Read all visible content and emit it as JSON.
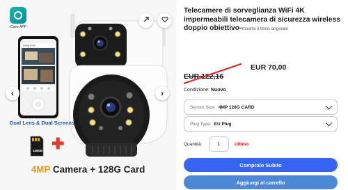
{
  "gallery": {
    "app_name": "iCsee APP",
    "phone_header": "Living room",
    "caption_lens": "Dual Lens & Dual Screens",
    "sd_card_label": "128GB",
    "caption_storage_prefix": "4MP",
    "caption_storage_rest": " Camera + 128G Card",
    "share_icon": "share-icon",
    "fav_icon": "heart-icon"
  },
  "listing": {
    "title": "Telecamere di sorveglianza WiFi 4K impermeabili telecamera di sicurezza wireless doppio obiettivo-",
    "original_title_link": "mostra il titolo originale",
    "old_price": "EUR 122,16",
    "new_price": "EUR 70,00",
    "condition_label": "Condizione:",
    "condition_value": "Nuovo",
    "sensor_label": "Sensor Size:",
    "sensor_value": "4MP 128G CARD",
    "plug_label": "Plug Type:",
    "plug_value": "EU Plug",
    "quantity_label": "Quantità:",
    "quantity_value": "1",
    "quantity_note": "Ultimo",
    "buy_now": "Compralo Subito",
    "add_to_cart": "Aggiungi al carrello"
  },
  "colors": {
    "buy_button": "#3665f3",
    "cart_button": "#4c87d8",
    "strike_red": "#d9282a",
    "accent_orange": "#e59a19"
  }
}
